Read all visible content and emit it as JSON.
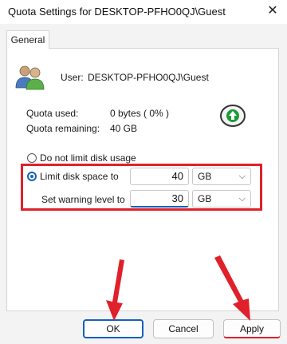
{
  "window": {
    "title": "Quota Settings for DESKTOP-PFHO0QJ\\Guest",
    "close_glyph": "✕"
  },
  "tabs": [
    {
      "label": "General",
      "selected": true
    }
  ],
  "user": {
    "label": "User:",
    "value": "DESKTOP-PFHO0QJ\\Guest",
    "icon": "users-icon"
  },
  "quota": {
    "used_label": "Quota used:",
    "used_value": "0 bytes ( 0% )",
    "remaining_label": "Quota remaining:",
    "remaining_value": "40 GB",
    "status_icon": "traffic-light-green-icon"
  },
  "options": {
    "no_limit_label": "Do not limit disk usage",
    "limit_label": "Limit disk space to",
    "limit_selected": true,
    "limit_value": "40",
    "limit_unit": "GB",
    "warning_label": "Set warning level to",
    "warning_value": "30",
    "warning_unit": "GB"
  },
  "buttons": {
    "ok": "OK",
    "cancel": "Cancel",
    "apply": "Apply"
  },
  "colors": {
    "accent": "#1560bd",
    "annotation_red": "#e0202a",
    "status_green": "#1e9a3a"
  }
}
